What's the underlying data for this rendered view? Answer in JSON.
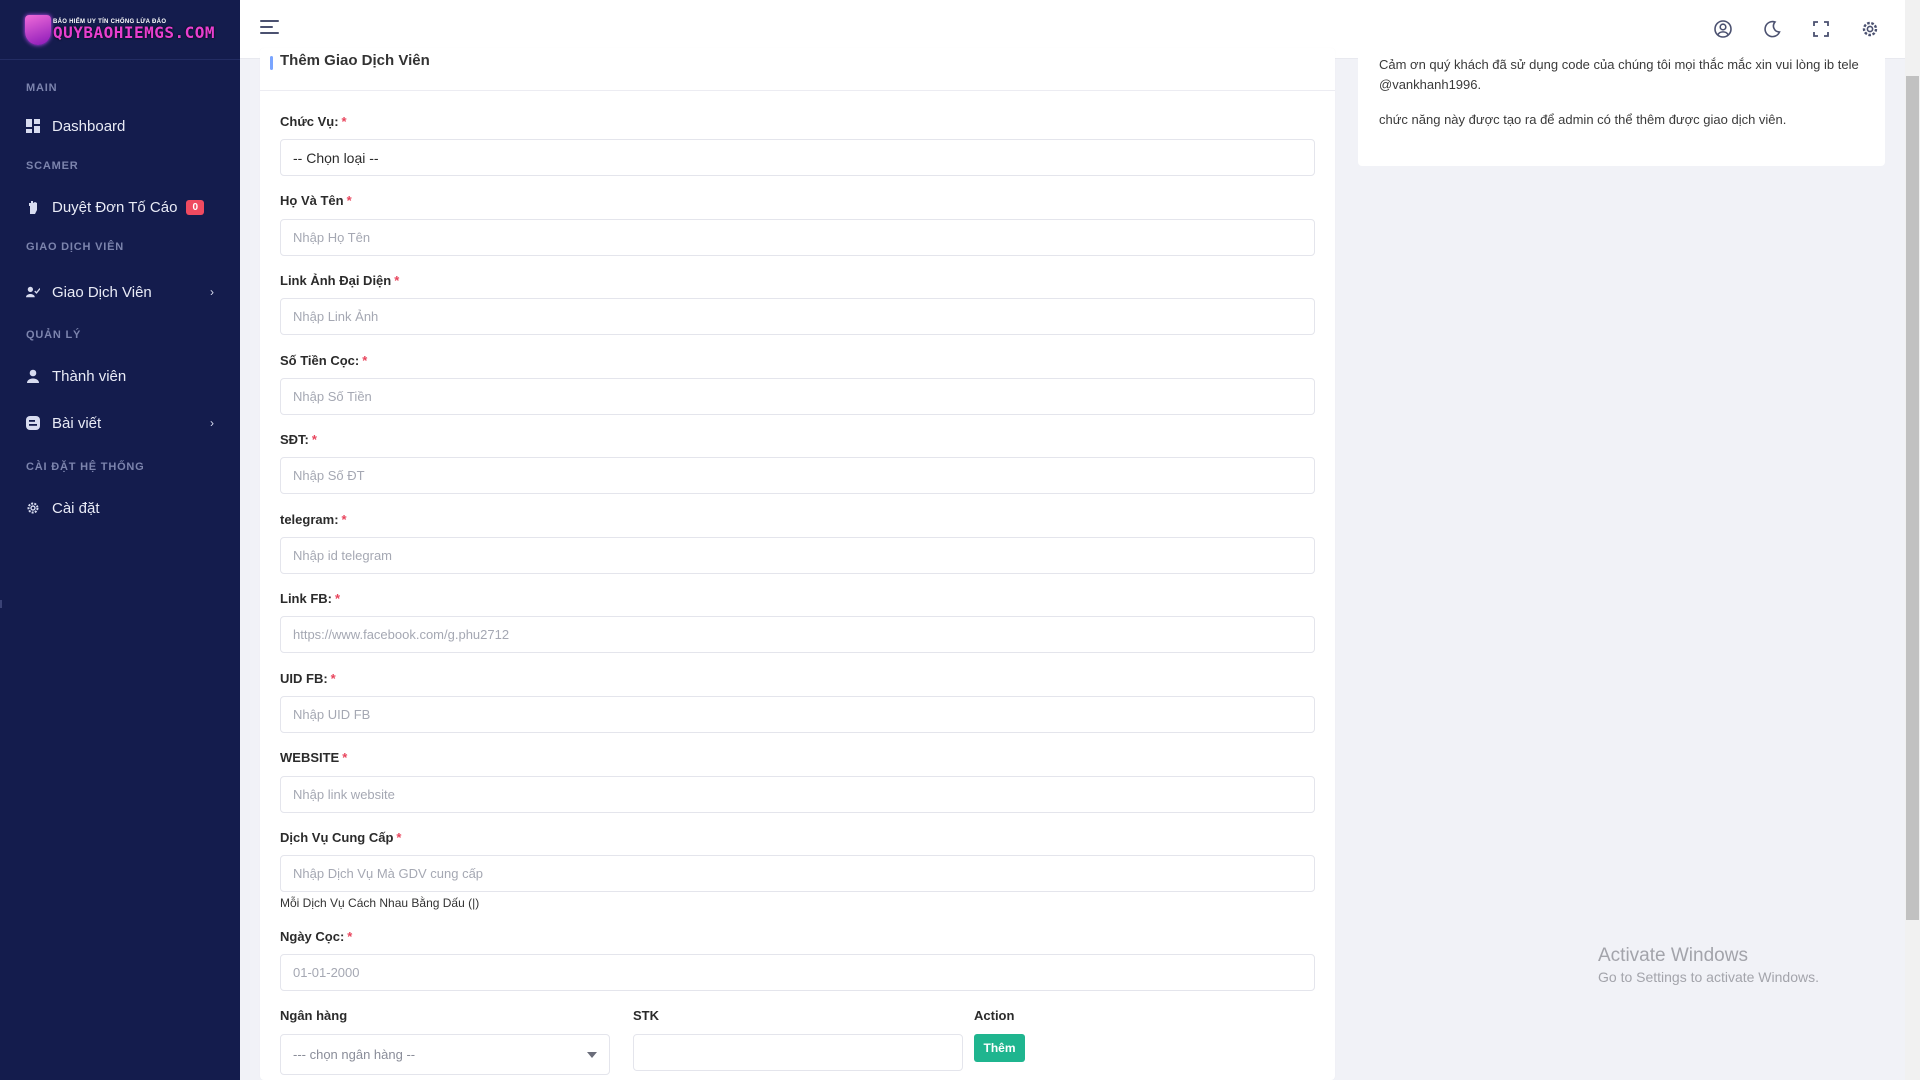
{
  "brand": {
    "logo_small": "BẢO HIỂM UY TÍN CHỐNG LỪA ĐẢO",
    "logo_big": "QUYBAOHIEMGS.COM"
  },
  "sidebar": {
    "cat_main": "MAIN",
    "item_dashboard": "Dashboard",
    "cat_scamer": "SCAMER",
    "item_duyet": "Duyệt Đơn Tố Cáo",
    "duyet_badge": "0",
    "cat_gdv": "GIAO DỊCH VIÊN",
    "item_gdv": "Giao Dịch Viên",
    "cat_quanly": "QUẢN LÝ",
    "item_thanhvien": "Thành viên",
    "item_baiviet": "Bài viết",
    "cat_caidat": "CÀI ĐẶT HỆ THỐNG",
    "item_caidat": "Cài đặt"
  },
  "topbar": {
    "icons": [
      "menu-icon",
      "user-circle-icon",
      "moon-icon",
      "fullscreen-icon",
      "gear-icon"
    ]
  },
  "form": {
    "title": "Thêm Giao Dịch Viên",
    "chucvu_label": "Chức Vụ:",
    "chucvu_value": "-- Chọn loại --",
    "hoten_label": "Họ Và Tên",
    "hoten_placeholder": "Nhập Họ Tên",
    "anh_label": "Link Ảnh Đại Diện",
    "anh_placeholder": "Nhập Link Ảnh",
    "tiencoc_label": "Số Tiền Cọc:",
    "tiencoc_placeholder": "Nhập Số Tiền",
    "sdt_label": "SĐT:",
    "sdt_placeholder": "Nhập Số ĐT",
    "telegram_label": "telegram:",
    "telegram_placeholder": "Nhập id telegram",
    "fb_label": "Link FB:",
    "fb_placeholder": "https://www.facebook.com/g.phu2712",
    "uid_label": "UID FB:",
    "uid_placeholder": "Nhập UID FB",
    "website_label": "WEBSITE",
    "website_placeholder": "Nhập link website",
    "dichvu_label": "Dịch Vụ Cung Cấp",
    "dichvu_placeholder": "Nhập Dịch Vụ Mà GDV cung cấp",
    "dichvu_hint": "Mỗi Dịch Vụ Cách Nhau Bằng Dấu (|)",
    "ngaycoc_label": "Ngày Cọc:",
    "ngaycoc_placeholder": "01-01-2000",
    "required_mark": "*",
    "bank_label": "Ngân hàng",
    "bank_select": "--- chọn ngân hàng --",
    "stk_label": "STK",
    "action_label": "Action",
    "add_button": "Thêm"
  },
  "side": {
    "line1": "Cảm ơn quý khách đã sử dụng code của chúng tôi mọi thắc mắc xin vui lòng ib tele @vankhanh1996.",
    "line2": "chức năng này được tạo ra để admin có thể thêm được giao dịch viên."
  },
  "watermark": {
    "title": "Activate Windows",
    "subtitle": "Go to Settings to activate Windows."
  },
  "colors": {
    "sidebar": "#141c4d",
    "badge": "#ef4a60",
    "button": "#1fb58f",
    "required": "#e8445c"
  }
}
